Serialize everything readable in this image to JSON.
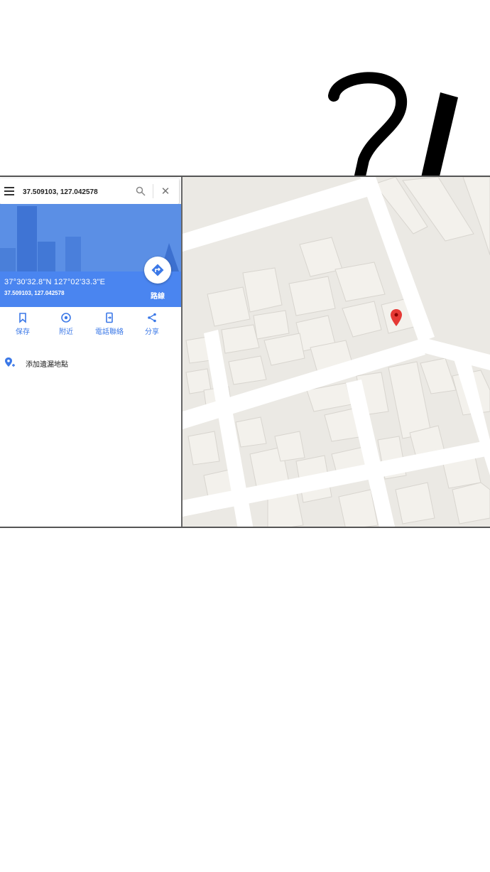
{
  "search": {
    "value": "37.509103, 127.042578"
  },
  "place": {
    "coords_dms": "37°30'32.8\"N 127°02'33.3\"E",
    "coords_decimal": "37.509103, 127.042578",
    "route_label": "路線"
  },
  "actions": [
    {
      "label": "保存",
      "icon": "bookmark-icon"
    },
    {
      "label": "附近",
      "icon": "nearby-icon"
    },
    {
      "label": "電話聯絡",
      "icon": "send-to-phone-icon"
    },
    {
      "label": "分享",
      "icon": "share-icon"
    }
  ],
  "add_missing_place": {
    "label": "添加遺漏地點",
    "icon": "add-location-icon"
  },
  "colors": {
    "accent": "#3b78e7",
    "header": "#5b8fe5",
    "pin": "#e53935",
    "map_background": "#ebe9e4",
    "building": "#f3f1ec"
  },
  "decoration": {
    "exclamation": "?!"
  }
}
